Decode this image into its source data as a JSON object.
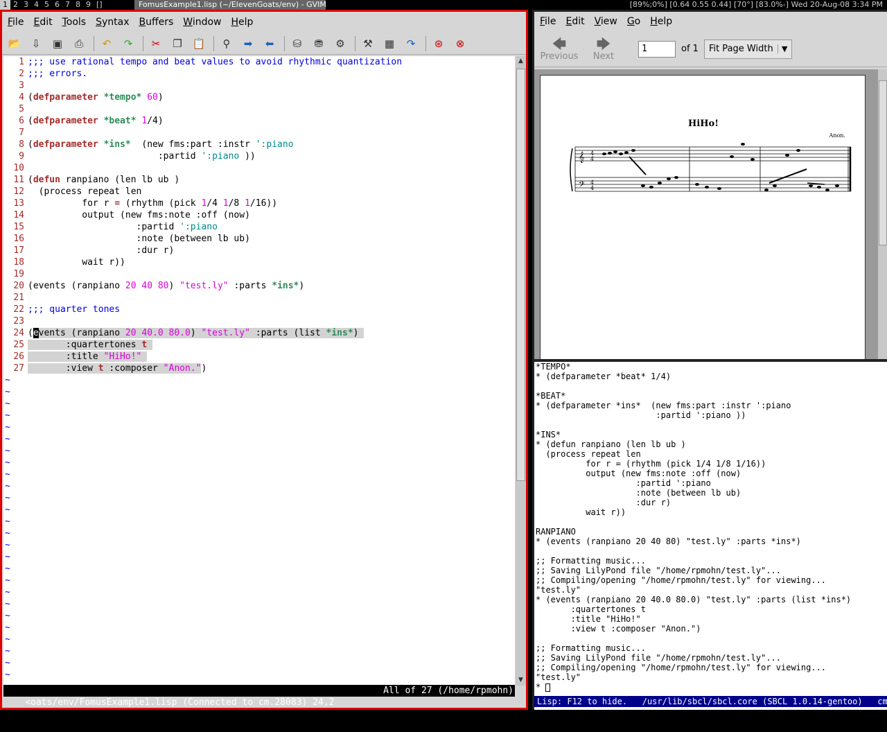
{
  "topbar": {
    "tags": [
      "1",
      "2",
      "3",
      "4",
      "5",
      "6",
      "7",
      "8",
      "9",
      "[]"
    ],
    "title": "FomusExample1.lisp (~/ElevenGoats/env) - GVIM",
    "status": "[89%;0%] [0.64 0.55 0.44] [70°] [83.0%-] Wed 20-Aug-08 3:34 PM"
  },
  "gvim": {
    "menu": [
      "File",
      "Edit",
      "Tools",
      "Syntax",
      "Buffers",
      "Window",
      "Help"
    ],
    "lines": [
      [
        [
          "c-com",
          ";;; use rational tempo and beat values to avoid rhythmic quantization"
        ]
      ],
      [
        [
          "c-com",
          ";;; errors."
        ]
      ],
      [],
      [
        [
          "c-pl",
          "("
        ],
        [
          "c-kw",
          "defparameter"
        ],
        [
          "c-pl",
          " "
        ],
        [
          "c-var",
          "*tempo*"
        ],
        [
          "c-pl",
          " "
        ],
        [
          "c-num",
          "60"
        ],
        [
          "c-pl",
          ")"
        ]
      ],
      [],
      [
        [
          "c-pl",
          "("
        ],
        [
          "c-kw",
          "defparameter"
        ],
        [
          "c-pl",
          " "
        ],
        [
          "c-var",
          "*beat*"
        ],
        [
          "c-pl",
          " "
        ],
        [
          "c-num",
          "1"
        ],
        [
          "c-pl",
          "/4)"
        ]
      ],
      [],
      [
        [
          "c-pl",
          "("
        ],
        [
          "c-kw",
          "defparameter"
        ],
        [
          "c-pl",
          " "
        ],
        [
          "c-var",
          "*ins*"
        ],
        [
          "c-pl",
          "  (new fms:part :instr "
        ],
        [
          "c-kwd",
          "':piano"
        ]
      ],
      [
        [
          "c-pl",
          "                        :partid "
        ],
        [
          "c-kwd",
          "':piano"
        ],
        [
          "c-pl",
          " ))"
        ]
      ],
      [],
      [
        [
          "c-pl",
          "("
        ],
        [
          "c-kw",
          "defun"
        ],
        [
          "c-pl",
          " ranpiano (len lb ub )"
        ]
      ],
      [
        [
          "c-pl",
          "  (process repeat len"
        ]
      ],
      [
        [
          "c-pl",
          "          for r "
        ],
        [
          "c-kw",
          "="
        ],
        [
          "c-pl",
          " (rhythm (pick "
        ],
        [
          "c-num",
          "1"
        ],
        [
          "c-pl",
          "/4 "
        ],
        [
          "c-num",
          "1"
        ],
        [
          "c-pl",
          "/8 "
        ],
        [
          "c-num",
          "1"
        ],
        [
          "c-pl",
          "/16))"
        ]
      ],
      [
        [
          "c-pl",
          "          output (new fms:note :off (now)"
        ]
      ],
      [
        [
          "c-pl",
          "                    :partid "
        ],
        [
          "c-kwd",
          "':piano"
        ]
      ],
      [
        [
          "c-pl",
          "                    :note (between lb ub)"
        ]
      ],
      [
        [
          "c-pl",
          "                    :dur r)"
        ]
      ],
      [
        [
          "c-pl",
          "          wait r))"
        ]
      ],
      [],
      [
        [
          "c-pl",
          "(events (ranpiano "
        ],
        [
          "c-num",
          "20"
        ],
        [
          "c-pl",
          " "
        ],
        [
          "c-num",
          "40"
        ],
        [
          "c-pl",
          " "
        ],
        [
          "c-num",
          "80"
        ],
        [
          "c-pl",
          ") "
        ],
        [
          "c-str",
          "\"test.ly\""
        ],
        [
          "c-pl",
          " :parts "
        ],
        [
          "c-var",
          "*ins*"
        ],
        [
          "c-pl",
          ")"
        ]
      ],
      [],
      [
        [
          "c-com",
          ";;; quarter tones"
        ]
      ],
      [],
      [
        [
          "c-pl",
          "("
        ],
        [
          "cursor",
          "e"
        ],
        [
          "c-pl vsel",
          "vents (ranpiano "
        ],
        [
          "c-num vsel",
          "20"
        ],
        [
          "c-pl vsel",
          " "
        ],
        [
          "c-num vsel",
          "40.0"
        ],
        [
          "c-pl vsel",
          " "
        ],
        [
          "c-num vsel",
          "80.0"
        ],
        [
          "c-pl vsel",
          ") "
        ],
        [
          "c-str vsel",
          "\"test.ly\""
        ],
        [
          "c-pl vsel",
          " :parts (list "
        ],
        [
          "c-var vsel",
          "*ins*"
        ],
        [
          "c-pl vsel",
          ") "
        ]
      ],
      [
        [
          "c-pl vsel",
          "       :quartertones "
        ],
        [
          "c-kw vsel",
          "t"
        ],
        [
          "c-pl vsel",
          " "
        ]
      ],
      [
        [
          "c-pl vsel",
          "       :title "
        ],
        [
          "c-str vsel",
          "\"HiHo!\""
        ],
        [
          "c-pl vsel",
          " "
        ]
      ],
      [
        [
          "c-pl vsel",
          "       :view "
        ],
        [
          "c-kw vsel",
          "t"
        ],
        [
          "c-pl vsel",
          " :composer "
        ],
        [
          "c-str vsel",
          "\"Anon.\""
        ],
        [
          "c-pl",
          ")"
        ]
      ]
    ],
    "tilde": "~",
    "status_left": "<oats/env/FomusExample1.lisp (Connected to cm.28083) 24,2",
    "status_right": "All of 27 (/home/rpmohn)"
  },
  "evince": {
    "menu": [
      "File",
      "Edit",
      "View",
      "Go",
      "Help"
    ],
    "previous_label": "Previous",
    "next_label": "Next",
    "page_value": "1",
    "of_label": "of 1",
    "zoom_label": "Fit Page Width",
    "score": {
      "title": "HiHo!",
      "composer": "Anon."
    }
  },
  "repl": {
    "lines": [
      "*TEMPO*",
      "* (defparameter *beat* 1/4)",
      "",
      "*BEAT*",
      "* (defparameter *ins*  (new fms:part :instr ':piano",
      "                        :partid ':piano ))",
      "",
      "*INS*",
      "* (defun ranpiano (len lb ub )",
      "  (process repeat len",
      "          for r = (rhythm (pick 1/4 1/8 1/16))",
      "          output (new fms:note :off (now)",
      "                    :partid ':piano",
      "                    :note (between lb ub)",
      "                    :dur r)",
      "          wait r))",
      "",
      "RANPIANO",
      "* (events (ranpiano 20 40 80) \"test.ly\" :parts *ins*)",
      "",
      ";; Formatting music...",
      ";; Saving LilyPond file \"/home/rpmohn/test.ly\"...",
      ";; Compiling/opening \"/home/rpmohn/test.ly\" for viewing...",
      "\"test.ly\"",
      "* (events (ranpiano 20 40.0 80.0) \"test.ly\" :parts (list *ins*)",
      "       :quartertones t",
      "       :title \"HiHo!\"",
      "       :view t :composer \"Anon.\")",
      "",
      ";; Formatting music...",
      ";; Saving LilyPond file \"/home/rpmohn/test.ly\"...",
      ";; Compiling/opening \"/home/rpmohn/test.ly\" for viewing...",
      "\"test.ly\"",
      "* "
    ],
    "mode_line": "Lisp: F12 to hide.   /usr/lib/sbcl/sbcl.core (SBCL 1.0.14-gentoo)   cm"
  }
}
